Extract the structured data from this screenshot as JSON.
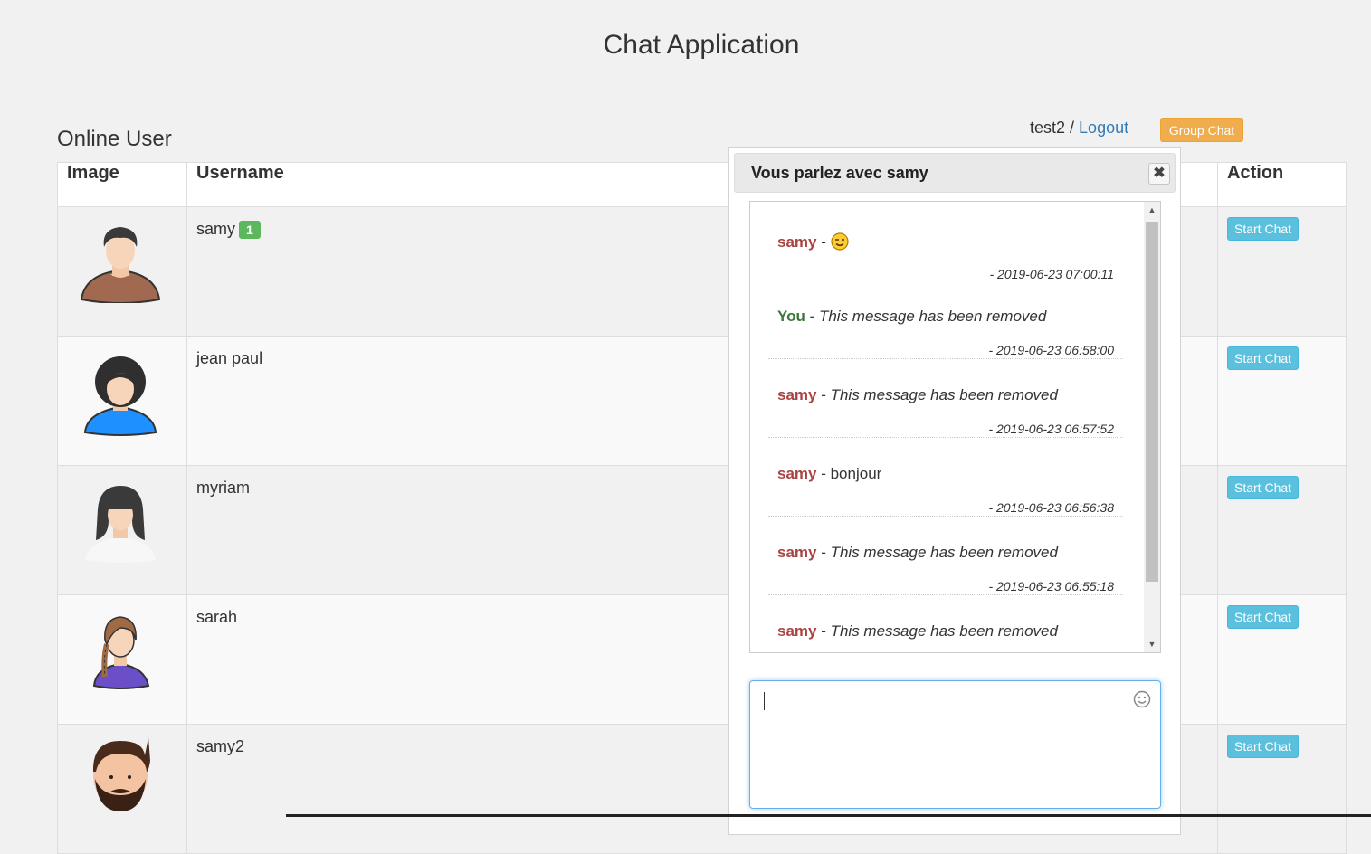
{
  "page": {
    "title": "Chat Application"
  },
  "section": {
    "title": "Online User"
  },
  "current_user": {
    "name": "test2",
    "separator": " / ",
    "logout_label": "Logout"
  },
  "group_chat_label": "Group Chat",
  "table": {
    "headers": {
      "image": "Image",
      "username": "Username",
      "action": "Action"
    },
    "rows": [
      {
        "username": "samy",
        "badge": "1",
        "action": "Start Chat",
        "avatar": "male-short-hair-avatar-icon"
      },
      {
        "username": "jean paul",
        "badge": "",
        "action": "Start Chat",
        "avatar": "male-afro-avatar-icon"
      },
      {
        "username": "myriam",
        "badge": "",
        "action": "Start Chat",
        "avatar": "female-long-hair-avatar-icon"
      },
      {
        "username": "sarah",
        "badge": "",
        "action": "Start Chat",
        "avatar": "female-braid-avatar-icon"
      },
      {
        "username": "samy2",
        "badge": "",
        "action": "Start Chat",
        "avatar": "male-beard-avatar-icon"
      }
    ]
  },
  "chat": {
    "title": "Vous parlez avec samy",
    "close_icon": "close-icon",
    "messages": [
      {
        "author": "samy",
        "separator": " - ",
        "text": "",
        "emoji": "wink-emoji",
        "time": "- 2019-06-23 07:00:11"
      },
      {
        "author": "You",
        "separator": " - ",
        "text": "This message has been removed",
        "time": "- 2019-06-23 06:58:00"
      },
      {
        "author": "samy",
        "separator": " - ",
        "text": "This message has been removed",
        "time": "- 2019-06-23 06:57:52"
      },
      {
        "author": "samy",
        "separator": " - ",
        "text": "bonjour",
        "time": "- 2019-06-23 06:56:38"
      },
      {
        "author": "samy",
        "separator": " - ",
        "text": "This message has been removed",
        "time": "- 2019-06-23 06:55:18"
      },
      {
        "author": "samy",
        "separator": " - ",
        "text": "This message has been removed",
        "time": ""
      }
    ],
    "input_value": "",
    "emoji_picker_icon": "smiley-icon"
  },
  "colors": {
    "other_author": "#a94442",
    "self_author": "#3c763d",
    "badge": "#5cb85c",
    "start_button": "#5bc0de",
    "group_button": "#f0ad4e",
    "link": "#337ab7"
  }
}
